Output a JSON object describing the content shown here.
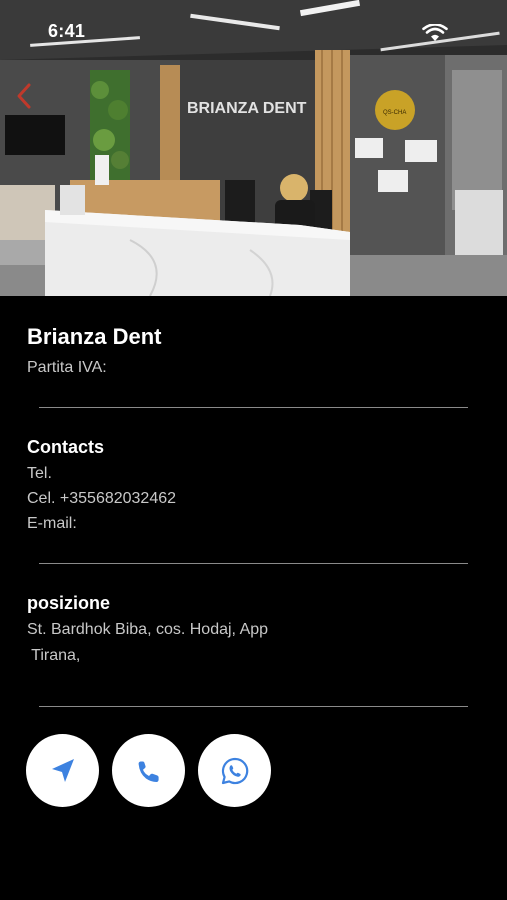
{
  "status_bar": {
    "time": "6:41"
  },
  "hero": {
    "sign_text": "BRIANZA DENT",
    "badge_text": "QS-CHA"
  },
  "clinic": {
    "name": "Brianza Dent",
    "piva": "Partita IVA:"
  },
  "contacts": {
    "title": "Contacts",
    "tel": "Tel.",
    "cel": "Cel. +355682032462",
    "email": "E-mail:"
  },
  "position": {
    "title": "posizione",
    "address_line1": "St. Bardhok Biba, cos. Hodaj, App",
    "address_line2": " Tirana,"
  },
  "actions": [
    {
      "icon": "navigation-arrow-icon"
    },
    {
      "icon": "phone-icon"
    },
    {
      "icon": "whatsapp-icon"
    }
  ],
  "colors": {
    "accent": "#3d82e0",
    "background": "#000000",
    "back_arrow": "#c0392b"
  }
}
